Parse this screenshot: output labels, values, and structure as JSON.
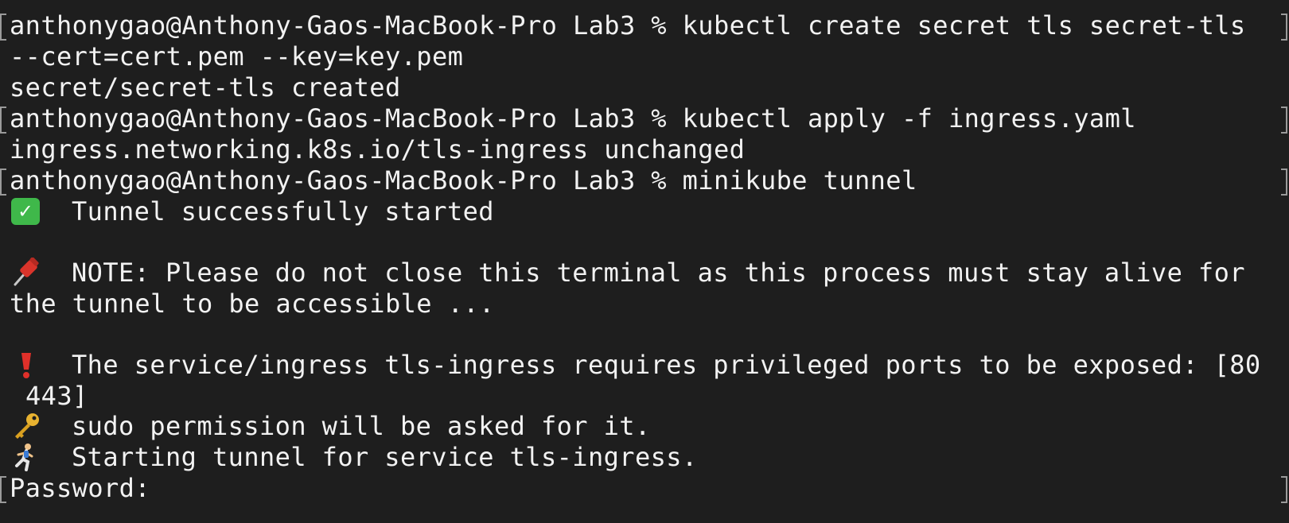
{
  "terminal": {
    "prompt": "anthonygao@Anthony-Gaos-MacBook-Pro Lab3 % ",
    "cmd1": "kubectl create secret tls secret-tls",
    "cmd1_cont": "--cert=cert.pem --key=key.pem",
    "out1": "secret/secret-tls created",
    "cmd2": "kubectl apply -f ingress.yaml",
    "out2": "ingress.networking.k8s.io/tls-ingress unchanged",
    "cmd3": "minikube tunnel",
    "tunnel_started": "Tunnel successfully started",
    "note_line1": "NOTE: Please do not close this terminal as this process must stay alive for",
    "note_line2": "the tunnel to be accessible ...",
    "warn_line1": "The service/ingress tls-ingress requires privileged ports to be exposed: [80",
    "warn_line2": "443]",
    "sudo_msg": "sudo permission will be asked for it.",
    "starting_msg": "Starting tunnel for service tls-ingress.",
    "password_prompt": "Password:"
  },
  "icons": {
    "check": "check-mark-button-icon",
    "pin": "pushpin-icon",
    "exclaim": "exclamation-icon",
    "key": "key-icon",
    "runner": "runner-icon"
  },
  "colors": {
    "background": "#1e1e1e",
    "text": "#f2f2f2",
    "check_green": "#3fb84a",
    "exclaim_red": "#e0302a",
    "pin_red": "#d9342b",
    "key_gold": "#e8b230"
  }
}
